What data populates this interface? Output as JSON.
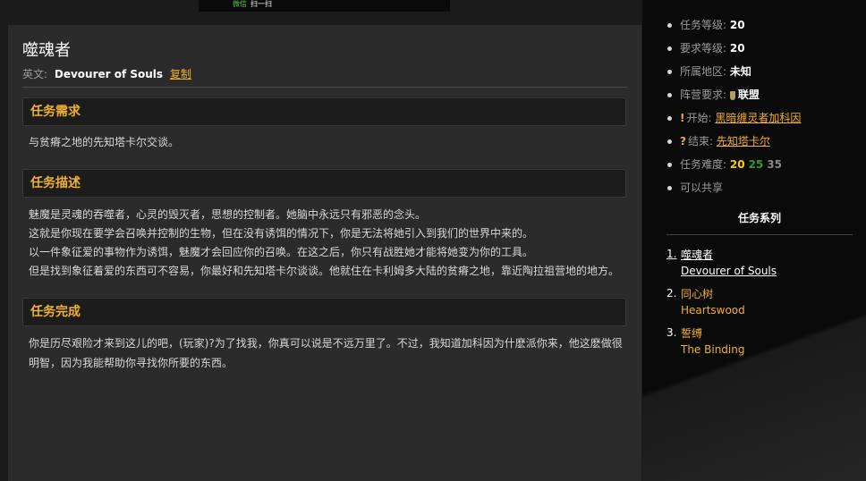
{
  "banner": {
    "app": "微信",
    "action": "扫一扫"
  },
  "quest": {
    "title": "噬魂者",
    "english_label": "英文:",
    "english_name": "Devourer of Souls",
    "copy_label": "复制",
    "requirements": {
      "heading": "任务需求",
      "lines": [
        "与贫瘠之地的先知塔卡尔交谈。"
      ]
    },
    "description": {
      "heading": "任务描述",
      "lines": [
        "魅魔是灵魂的吞噬者，心灵的毁灭者，思想的控制者。她脑中永远只有邪恶的念头。",
        "这就是你现在要学会召唤并控制的生物，但在没有诱饵的情况下，你是无法将她引入到我们的世界中来的。",
        "以一件象征爱的事物作为诱饵，魅魔才会回应你的召唤。在这之后，你只有战胜她才能将她变为你的工具。",
        "但是找到象征着爱的东西可不容易，你最好和先知塔卡尔谈谈。他就住在卡利姆多大陆的贫瘠之地，靠近陶拉祖营地的地方。"
      ]
    },
    "completion": {
      "heading": "任务完成",
      "text": "你是历尽艰险才来到这儿的吧，(玩家)?为了找我，你真可以说是不远万里了。不过，我知道加科因为什麽派你来，他这麽做很明智，因为我能帮助你寻找你所要的东西。"
    }
  },
  "sidebar": {
    "quest_level_label": "任务等级:",
    "quest_level": "20",
    "req_level_label": "要求等级:",
    "req_level": "20",
    "zone_label": "所属地区:",
    "zone": "未知",
    "faction_label": "阵营要求:",
    "faction": "联盟",
    "start_label": "开始:",
    "start_npc": "黑暗缠灵者加科因",
    "end_label": "结束:",
    "end_npc": "先知塔卡尔",
    "difficulty_label": "任务难度:",
    "difficulty": [
      "20",
      "25",
      "35"
    ],
    "shareable": "可以共享",
    "series_title": "任务系列",
    "series": [
      {
        "num": "1.",
        "cn": "噬魂者",
        "en": "Devourer of Souls"
      },
      {
        "num": "2.",
        "cn": "同心树",
        "en": "Heartswood"
      },
      {
        "num": "3.",
        "cn": "誓缚",
        "en": "The Binding"
      }
    ]
  },
  "colors": {
    "accent": "#f0b030",
    "panel": "#2b2b2b",
    "sidebar": "#0a0a0a",
    "difficulty_green": "#2f9a2f",
    "difficulty_yellow": "#f0d000"
  },
  "icons": [
    "shield-icon",
    "quest-start-icon",
    "quest-end-icon"
  ]
}
